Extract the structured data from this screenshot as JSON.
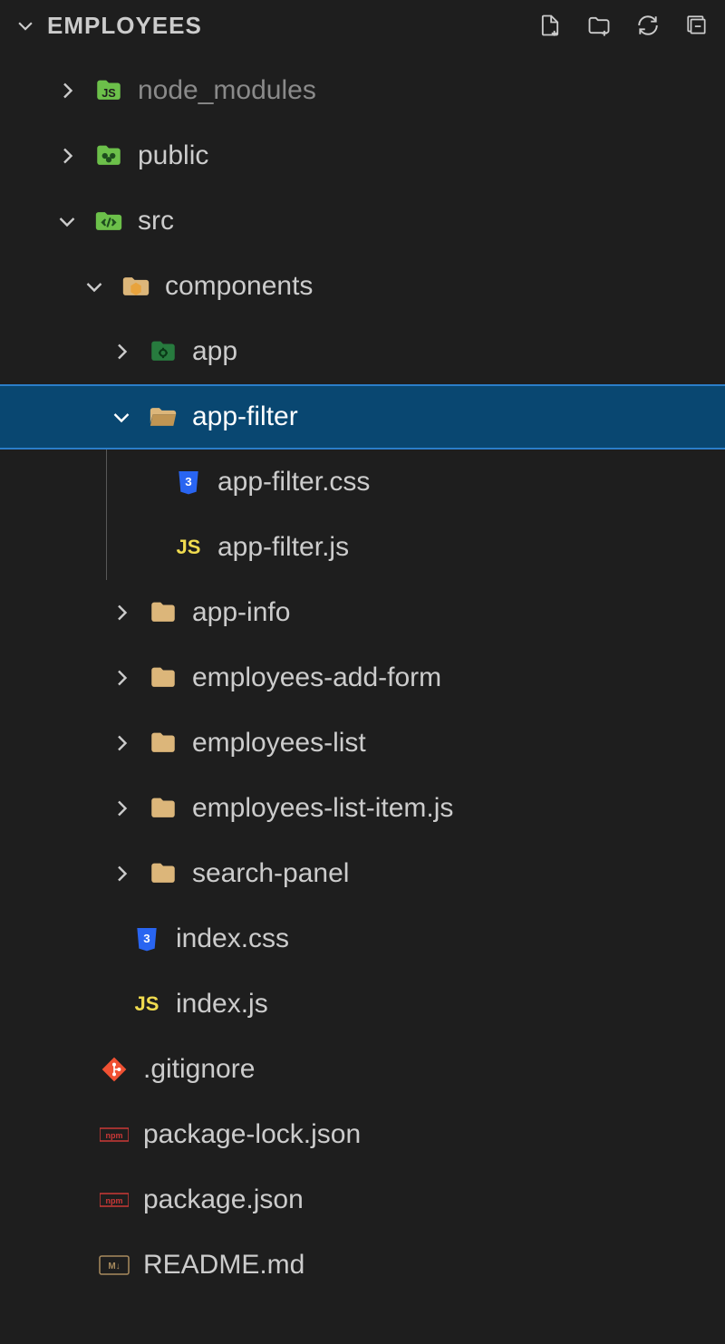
{
  "header": {
    "title": "EMPLOYEES"
  },
  "tree": {
    "items": [
      {
        "label": "node_modules",
        "type": "folder",
        "expanded": false,
        "indent": 1,
        "icon": "node",
        "dimmed": true
      },
      {
        "label": "public",
        "type": "folder",
        "expanded": false,
        "indent": 1,
        "icon": "public"
      },
      {
        "label": "src",
        "type": "folder",
        "expanded": true,
        "indent": 1,
        "icon": "src"
      },
      {
        "label": "components",
        "type": "folder",
        "expanded": true,
        "indent": 2,
        "icon": "components"
      },
      {
        "label": "app",
        "type": "folder",
        "expanded": false,
        "indent": 3,
        "icon": "app"
      },
      {
        "label": "app-filter",
        "type": "folder",
        "expanded": true,
        "indent": 3,
        "icon": "folder-open",
        "selected": true
      },
      {
        "label": "app-filter.css",
        "type": "file",
        "indent": 4,
        "icon": "css",
        "guide": true
      },
      {
        "label": "app-filter.js",
        "type": "file",
        "indent": 4,
        "icon": "js",
        "guide": true
      },
      {
        "label": "app-info",
        "type": "folder",
        "expanded": false,
        "indent": 3,
        "icon": "folder"
      },
      {
        "label": "employees-add-form",
        "type": "folder",
        "expanded": false,
        "indent": 3,
        "icon": "folder"
      },
      {
        "label": "employees-list",
        "type": "folder",
        "expanded": false,
        "indent": 3,
        "icon": "folder"
      },
      {
        "label": "employees-list-item.js",
        "type": "folder",
        "expanded": false,
        "indent": 3,
        "icon": "folder"
      },
      {
        "label": "search-panel",
        "type": "folder",
        "expanded": false,
        "indent": 3,
        "icon": "folder"
      },
      {
        "label": "index.css",
        "type": "file",
        "indent": 2,
        "icon": "css"
      },
      {
        "label": "index.js",
        "type": "file",
        "indent": 2,
        "icon": "js"
      },
      {
        "label": ".gitignore",
        "type": "file",
        "indent": 1,
        "icon": "git"
      },
      {
        "label": "package-lock.json",
        "type": "file",
        "indent": 1,
        "icon": "npm"
      },
      {
        "label": "package.json",
        "type": "file",
        "indent": 1,
        "icon": "npm"
      },
      {
        "label": "README.md",
        "type": "file",
        "indent": 1,
        "icon": "md"
      }
    ]
  }
}
